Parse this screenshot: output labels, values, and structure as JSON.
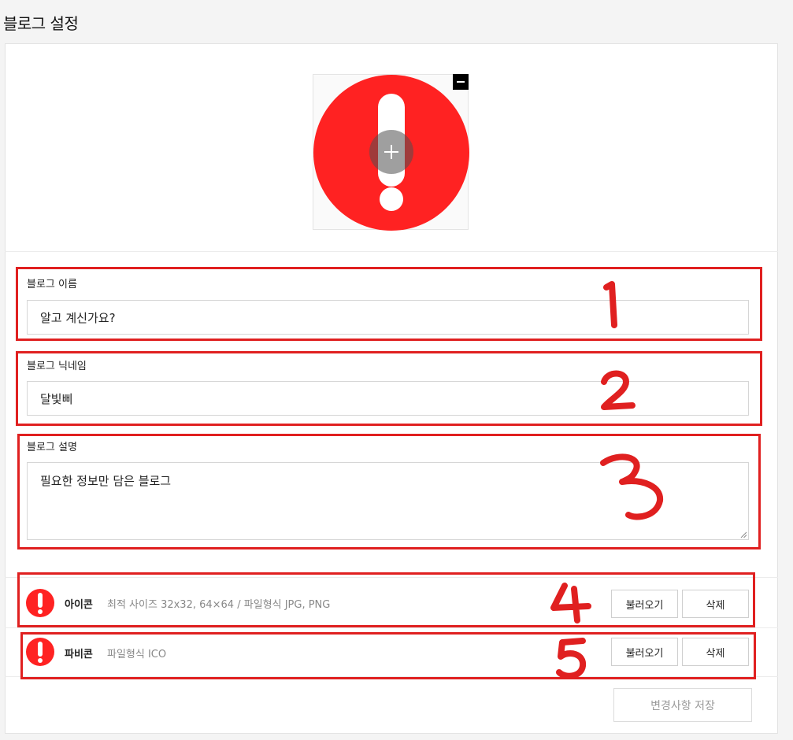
{
  "page": {
    "title": "블로그 설정"
  },
  "logo": {
    "remove_icon": "minus-icon",
    "add_icon": "plus-icon",
    "image": "red-exclamation-icon"
  },
  "fields": {
    "name": {
      "label": "블로그 이름",
      "value": "알고 계신가요?"
    },
    "nickname": {
      "label": "블로그 닉네임",
      "value": "달빛삐"
    },
    "description": {
      "label": "블로그 설명",
      "value": "필요한 정보만 담은 블로그"
    }
  },
  "icon_setting": {
    "label": "아이콘",
    "description": "최적 사이즈 32x32, 64×64 / 파일형식 JPG, PNG",
    "load_label": "불러오기",
    "delete_label": "삭제"
  },
  "favicon_setting": {
    "label": "파비콘",
    "description": "파일형식 ICO",
    "load_label": "불러오기",
    "delete_label": "삭제"
  },
  "save_label": "변경사항 저장",
  "annotations": [
    "1",
    "2",
    "3",
    "4",
    "5"
  ],
  "colors": {
    "annotation": "#e02020",
    "icon_red": "#ff2222"
  }
}
